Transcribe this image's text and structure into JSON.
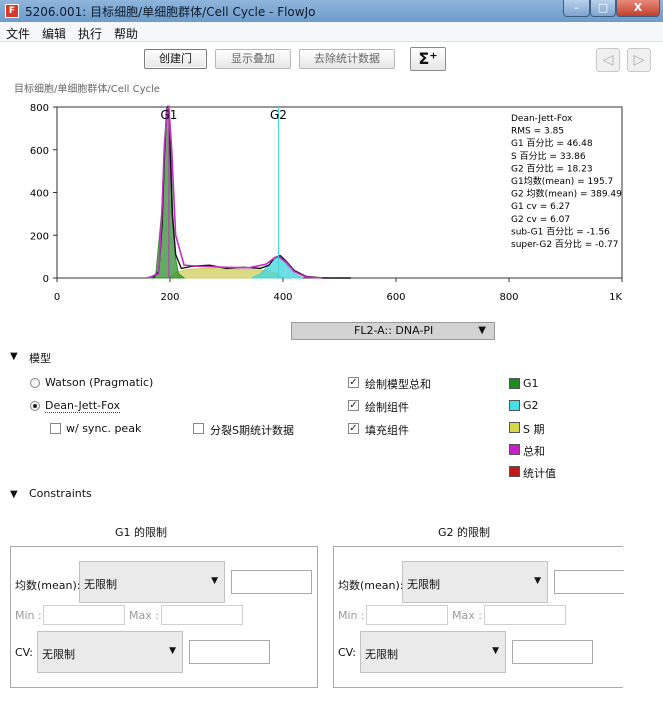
{
  "window": {
    "title": "5206.001: 目标细胞/单细胞群体/Cell Cycle - FlowJo",
    "app_icon": "flowjo-app-icon",
    "min_label": "–",
    "max_label": "□",
    "close_label": "X"
  },
  "menu": [
    "文件",
    "编辑",
    "执行",
    "帮助"
  ],
  "toolbar": {
    "gates_label": "创建门",
    "overlay_label": "显示叠加",
    "remove_stats_label": "去除统计数据",
    "sigma_label": "Σ⁺",
    "prev_label": "◁",
    "next_label": "▷"
  },
  "breadcrumb": "目标细胞/单细胞群体/Cell Cycle",
  "stats": [
    "Dean-Jett-Fox",
    "RMS  = 3.85",
    "G1 百分比 = 46.48",
    "S 百分比 = 33.86",
    "G2 百分比 = 18.23",
    "G1均数(mean) = 195.7",
    "G2 均数(mean) = 389.49",
    "G1 cv = 6.27",
    "G2 cv = 6.07",
    "sub-G1 百分比 = -1.56",
    "super-G2 百分比 = -0.77"
  ],
  "chart_data": {
    "type": "area",
    "x_ticks": [
      "0",
      "200",
      "400",
      "600",
      "800",
      "1K"
    ],
    "y_ticks": [
      "0",
      "200",
      "400",
      "600",
      "800"
    ],
    "xlim": [
      0,
      1000
    ],
    "ylim": [
      0,
      800
    ],
    "peak_labels": [
      {
        "text": "G1",
        "x": 198
      },
      {
        "text": "G2",
        "x": 392
      }
    ],
    "histogram": {
      "x": [
        170,
        180,
        186,
        190,
        194,
        196,
        198,
        200,
        204,
        210,
        220,
        240,
        270,
        300,
        330,
        360,
        375,
        385,
        395,
        405,
        420,
        440,
        470,
        520
      ],
      "y": [
        0,
        30,
        250,
        560,
        790,
        800,
        770,
        620,
        300,
        110,
        45,
        55,
        60,
        45,
        50,
        45,
        60,
        95,
        105,
        80,
        35,
        8,
        0,
        0
      ]
    },
    "series": [
      {
        "name": "G1",
        "color": "#2f8f2f",
        "x": [
          165,
          175,
          185,
          190,
          195,
          197,
          200,
          205,
          210,
          215,
          225
        ],
        "y": [
          0,
          20,
          300,
          600,
          780,
          790,
          700,
          300,
          90,
          20,
          0
        ]
      },
      {
        "name": "G2",
        "color": "#3fd4dc",
        "x": [
          345,
          360,
          375,
          385,
          392,
          400,
          410,
          420,
          435
        ],
        "y": [
          0,
          20,
          60,
          90,
          95,
          85,
          50,
          20,
          0
        ]
      },
      {
        "name": "S 期",
        "color": "#cfcf5a",
        "x": [
          195,
          210,
          230,
          260,
          300,
          340,
          370,
          390,
          400
        ],
        "y": [
          0,
          25,
          40,
          45,
          42,
          40,
          35,
          20,
          0
        ]
      },
      {
        "name": "总和",
        "color": "#c22fc2",
        "x": [
          160,
          180,
          186,
          190,
          195,
          198,
          203,
          210,
          225,
          250,
          300,
          340,
          370,
          385,
          392,
          405,
          420,
          440,
          470
        ],
        "y": [
          0,
          20,
          330,
          620,
          790,
          800,
          600,
          200,
          60,
          55,
          50,
          48,
          65,
          95,
          100,
          75,
          30,
          5,
          0
        ]
      }
    ],
    "xlabel": "FL2-A:: DNA-PI",
    "ylabel": "",
    "grid": false
  },
  "axis_select": {
    "value": "FL2-A:: DNA-PI",
    "arrow": "▼"
  },
  "model_section": {
    "toggle": "▼",
    "title": "模型",
    "watson_label": "Watson (Pragmatic)",
    "djf_label": "Dean-Jett-Fox",
    "sync_peak_label": "w/ sync. peak",
    "split_s_label": "分裂S期统计数据",
    "plot_model_label": "绘制模型总和",
    "plot_components_label": "绘制组件",
    "fill_components_label": "填充组件",
    "checked_glyph": "✓"
  },
  "legend": [
    {
      "label": "G1",
      "color": "#1f8a1f"
    },
    {
      "label": "G2",
      "color": "#44e0ea"
    },
    {
      "label": "S 期",
      "color": "#d6d64a"
    },
    {
      "label": "总和",
      "color": "#c81ec8"
    },
    {
      "label": "统计值",
      "color": "#c01a1a"
    }
  ],
  "constraints": {
    "toggle": "▼",
    "title": "Constraints",
    "g1": {
      "title": "G1 的限制",
      "mean_label": "均数(mean):",
      "mean_value": "无限制",
      "min_label": "Min :",
      "max_label": "Max :",
      "cv_label": "CV:",
      "cv_value": "无限制",
      "arrow": "▼"
    },
    "g2": {
      "title": "G2 的限制",
      "mean_label": "均数(mean):",
      "mean_value": "无限制",
      "min_label": "Min :",
      "max_label": "Max :",
      "cv_label": "CV:",
      "cv_value": "无限制",
      "arrow": "▼"
    }
  }
}
